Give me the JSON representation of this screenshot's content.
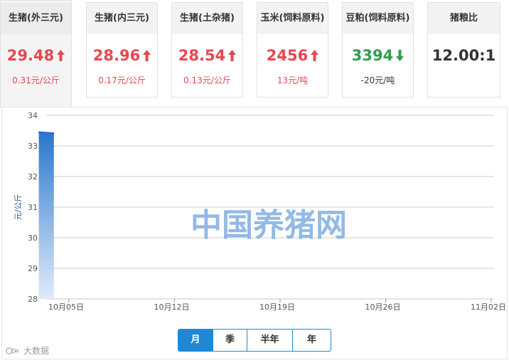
{
  "cards": [
    {
      "title": "生猪(外三元)",
      "price": "29.48",
      "change": "0.31元/公斤",
      "trend": "up"
    },
    {
      "title": "生猪(内三元)",
      "price": "28.96",
      "change": "0.17元/公斤",
      "trend": "up"
    },
    {
      "title": "生猪(土杂猪)",
      "price": "28.54",
      "change": "0.13元/公斤",
      "trend": "up"
    },
    {
      "title": "玉米(饲料原料)",
      "price": "2456",
      "change": "13元/吨",
      "trend": "up"
    },
    {
      "title": "豆粕(饲料原料)",
      "price": "3394",
      "change": "-20元/吨",
      "trend": "down"
    },
    {
      "title": "猪粮比",
      "price": "12.00:1",
      "change": "",
      "trend": "none"
    }
  ],
  "period_tabs": [
    "月",
    "季",
    "半年",
    "年"
  ],
  "active_period": "月",
  "watermark": "中国养猪网",
  "brand": "大数据",
  "colors": {
    "up": "#e8474f",
    "down": "#2e9f4a",
    "accent": "#1e88d6",
    "series": "#1e6fc9"
  },
  "chart_data": {
    "type": "area",
    "title": "",
    "xlabel": "",
    "ylabel": "元/公斤",
    "ylim": [
      28,
      34
    ],
    "yticks": [
      "28",
      "29",
      "30",
      "31",
      "32",
      "33",
      "34"
    ],
    "xticks": [
      "10月05日",
      "10月12日",
      "10月19日",
      "10月26日",
      "11月02日"
    ],
    "grid": true,
    "series": [
      {
        "x": [
          "10月03日",
          "10月04日"
        ],
        "values": [
          33.45,
          33.42
        ]
      }
    ]
  }
}
